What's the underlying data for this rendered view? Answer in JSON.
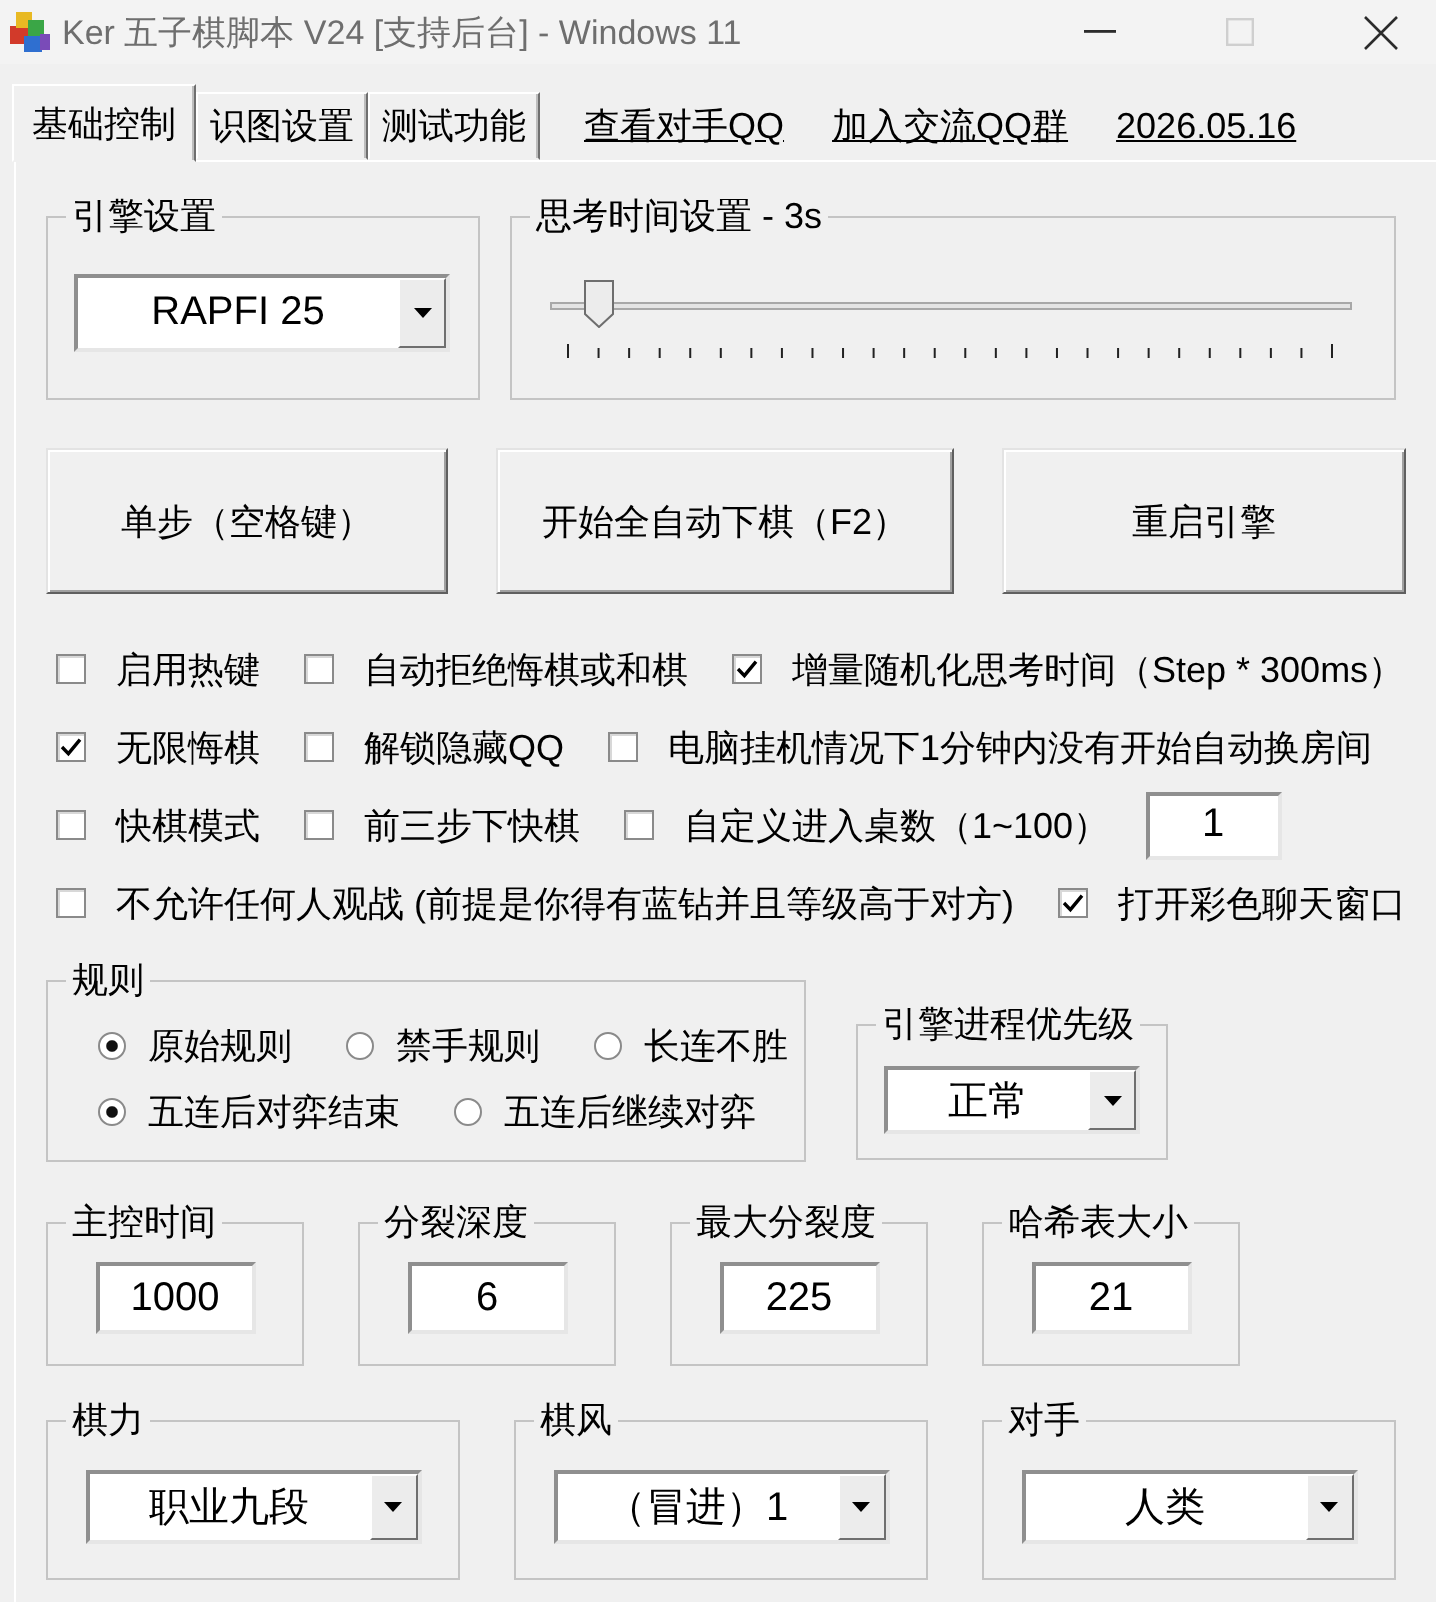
{
  "window": {
    "title": "Ker 五子棋脚本 V24 [支持后台] - Windows 11",
    "controls": [
      {
        "kind": "minimize",
        "disabled": false
      },
      {
        "kind": "maximize",
        "disabled": true
      },
      {
        "kind": "close",
        "disabled": false
      }
    ]
  },
  "tabs": [
    {
      "label": "基础控制",
      "selected": true
    },
    {
      "label": "识图设置",
      "selected": false
    },
    {
      "label": "测试功能",
      "selected": false
    }
  ],
  "links": [
    "查看对手QQ",
    "加入交流QQ群",
    "2026.05.16"
  ],
  "engine": {
    "label": "引擎设置",
    "value": "RAPFI 25"
  },
  "think_time": {
    "label": "思考时间设置 - 3s",
    "level": 0.04
  },
  "buttons": [
    "单步（空格键）",
    "开始全自动下棋（F2）",
    "重启引擎"
  ],
  "options": [
    [
      {
        "kind": "checkbox",
        "label": "启用热键",
        "checked": false
      },
      {
        "kind": "checkbox",
        "label": "自动拒绝悔棋或和棋",
        "checked": false
      },
      {
        "kind": "checkbox",
        "label": "增量随机化思考时间（Step * 300ms）",
        "checked": true
      }
    ],
    [
      {
        "kind": "checkbox",
        "label": "无限悔棋",
        "checked": true
      },
      {
        "kind": "checkbox",
        "label": "解锁隐藏QQ",
        "checked": false
      },
      {
        "kind": "checkbox",
        "label": "电脑挂机情况下1分钟内没有开始自动换房间",
        "checked": false
      }
    ],
    [
      {
        "kind": "checkbox",
        "label": "快棋模式",
        "checked": false
      },
      {
        "kind": "checkbox",
        "label": "前三步下快棋",
        "checked": false
      },
      {
        "kind": "checkbox",
        "label": "自定义进入桌数（1~100）",
        "checked": false
      },
      {
        "kind": "field",
        "value": "1"
      }
    ],
    [
      {
        "kind": "checkbox",
        "label": "不允许任何人观战 (前提是你得有蓝钻并且等级高于对方)",
        "checked": false
      },
      {
        "kind": "checkbox",
        "label": "打开彩色聊天窗口",
        "checked": true
      }
    ]
  ],
  "rules": {
    "label": "规则",
    "rows": [
      [
        {
          "label": "原始规则",
          "selected": true
        },
        {
          "label": "禁手规则",
          "selected": false
        },
        {
          "label": "长连不胜",
          "selected": false
        }
      ],
      [
        {
          "label": "五连后对弈结束",
          "selected": true
        },
        {
          "label": "五连后继续对弈",
          "selected": false
        }
      ]
    ]
  },
  "priority": {
    "label": "引擎进程优先级",
    "value": "正常"
  },
  "params": [
    {
      "label": "主控时间",
      "value": "1000"
    },
    {
      "label": "分裂深度",
      "value": "6"
    },
    {
      "label": "最大分裂度",
      "value": "225"
    },
    {
      "label": "哈希表大小",
      "value": "21"
    }
  ],
  "selectors": [
    {
      "label": "棋力",
      "value": "职业九段"
    },
    {
      "label": "棋风",
      "value": "（冒进）1"
    },
    {
      "label": "对手",
      "value": "人类"
    }
  ]
}
